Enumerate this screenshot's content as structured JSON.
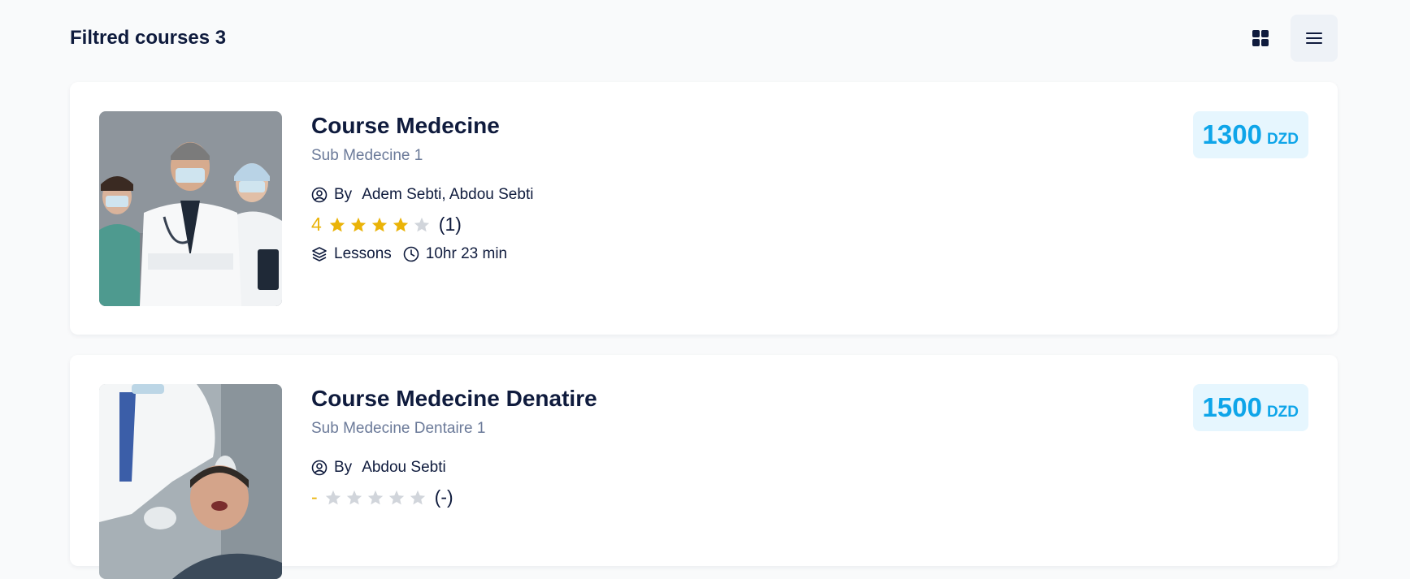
{
  "header": {
    "title": "Filtred courses 3"
  },
  "view_toggle": {
    "grid_icon": "grid-icon",
    "list_icon": "list-icon",
    "active": "list"
  },
  "courses": [
    {
      "title": "Course Medecine",
      "subtitle": "Sub Medecine 1",
      "by_label": "By",
      "authors": "Adem Sebti, Abdou Sebti",
      "rating": "4",
      "rating_value": 4,
      "rating_count": "(1)",
      "lessons_label": "Lessons",
      "duration": "10hr 23 min",
      "price": "1300",
      "currency": "DZD"
    },
    {
      "title": "Course Medecine Denatire",
      "subtitle": "Sub Medecine Dentaire 1",
      "by_label": "By",
      "authors": "Abdou Sebti",
      "rating": "-",
      "rating_value": 0,
      "rating_count": "(-)",
      "price": "1500",
      "currency": "DZD"
    }
  ],
  "colors": {
    "accent": "#0ea5e9",
    "star_filled": "#eab308",
    "star_empty": "#d1d5db",
    "text": "#0f1b3d",
    "muted": "#6b7a99"
  }
}
